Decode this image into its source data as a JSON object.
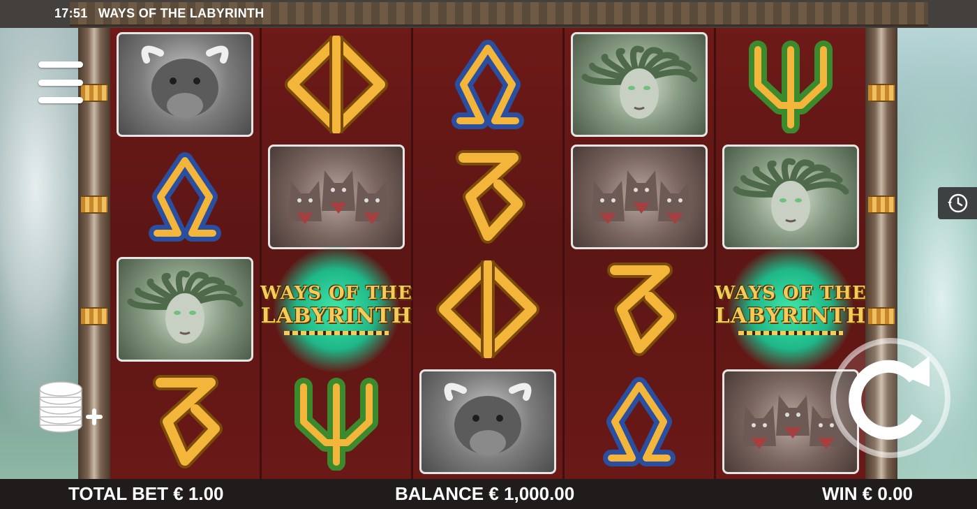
{
  "status_bar": {
    "time": "17:51",
    "game_title": "WAYS OF THE LABYRINTH"
  },
  "reels": [
    [
      "minotaur",
      "omega",
      "medusa",
      "delta"
    ],
    [
      "phi",
      "cerberus",
      "logo",
      "psi"
    ],
    [
      "omega",
      "delta",
      "phi",
      "minotaur"
    ],
    [
      "medusa",
      "cerberus",
      "delta",
      "omega"
    ],
    [
      "psi",
      "medusa",
      "logo",
      "cerberus"
    ]
  ],
  "logo_symbol": {
    "line1": "WAYS OF THE",
    "line2": "LABYRINTH"
  },
  "controls": {
    "menu": "menu-icon",
    "bet": "coin-stack-plus-icon",
    "history": "history-clock-icon",
    "spin": "spin-arrow-icon"
  },
  "bottom_bar": {
    "total_bet": "TOTAL BET € 1.00",
    "balance": "BALANCE € 1,000.00",
    "win": "WIN € 0.00"
  },
  "colors": {
    "reel_background": "#5c1614",
    "gold": "#f0b43a",
    "blue": "#2a4fa0",
    "green": "#3c8a2e",
    "logo_glow": "#2fd49a"
  }
}
